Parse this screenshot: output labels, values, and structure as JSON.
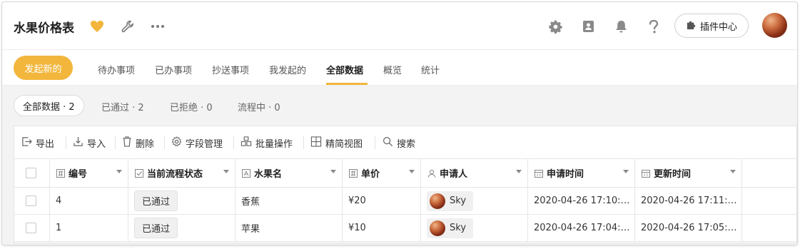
{
  "header": {
    "title": "水果价格表",
    "icons": [
      "heart-icon",
      "wrench-icon",
      "more-icon",
      "settings-icon",
      "contacts-icon",
      "bell-icon",
      "help-icon"
    ],
    "plugin_label": "插件中心",
    "accent": "#f2b63c"
  },
  "nav": {
    "new_label": "发起新的",
    "tabs": [
      {
        "label": "待办事项"
      },
      {
        "label": "已办事项"
      },
      {
        "label": "抄送事项"
      },
      {
        "label": "我发起的"
      },
      {
        "label": "全部数据",
        "active": true
      },
      {
        "label": "概览"
      },
      {
        "label": "统计"
      }
    ]
  },
  "filters": [
    {
      "label": "全部数据 · 2",
      "active": true
    },
    {
      "label": "已通过 · 2"
    },
    {
      "label": "已拒绝 · 0"
    },
    {
      "label": "流程中 · 0"
    }
  ],
  "toolbar": {
    "export": "导出",
    "import": "导入",
    "delete": "删除",
    "fields": "字段管理",
    "batch": "批量操作",
    "simple_view": "精简视图",
    "search": "搜索"
  },
  "table": {
    "columns": [
      "编号",
      "当前流程状态",
      "水果名",
      "单价",
      "申请人",
      "申请时间",
      "更新时间"
    ],
    "rows": [
      {
        "id": "4",
        "status": "已通过",
        "fruit": "香蕉",
        "price": "¥20",
        "applicant": "Sky",
        "applied": "2020-04-26 17:10:…",
        "updated": "2020-04-26 17:11:…"
      },
      {
        "id": "1",
        "status": "已通过",
        "fruit": "苹果",
        "price": "¥10",
        "applicant": "Sky",
        "applied": "2020-04-26 17:04:…",
        "updated": "2020-04-26 17:05:…"
      }
    ]
  }
}
